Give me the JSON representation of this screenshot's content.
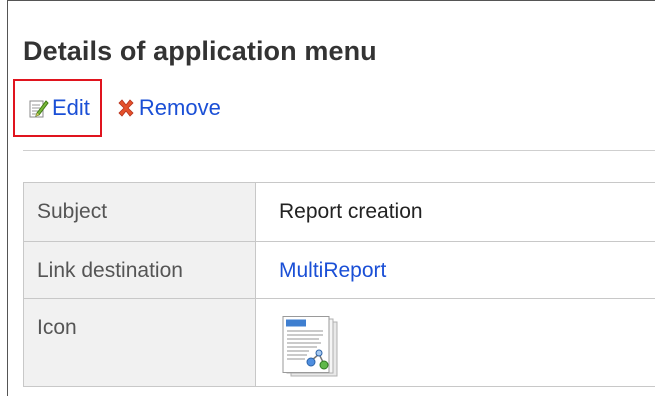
{
  "page": {
    "title": "Details of application menu"
  },
  "toolbar": {
    "edit_label": "Edit",
    "remove_label": "Remove",
    "edit_icon": "edit-icon",
    "remove_icon": "remove-icon",
    "highlight_color": "#e0141e",
    "link_color": "#1a4fd6"
  },
  "details": {
    "rows": [
      {
        "label": "Subject",
        "value": "Report creation"
      },
      {
        "label": "Link destination",
        "value": "MultiReport"
      },
      {
        "label": "Icon",
        "value_icon": "report-document-icon"
      }
    ]
  }
}
